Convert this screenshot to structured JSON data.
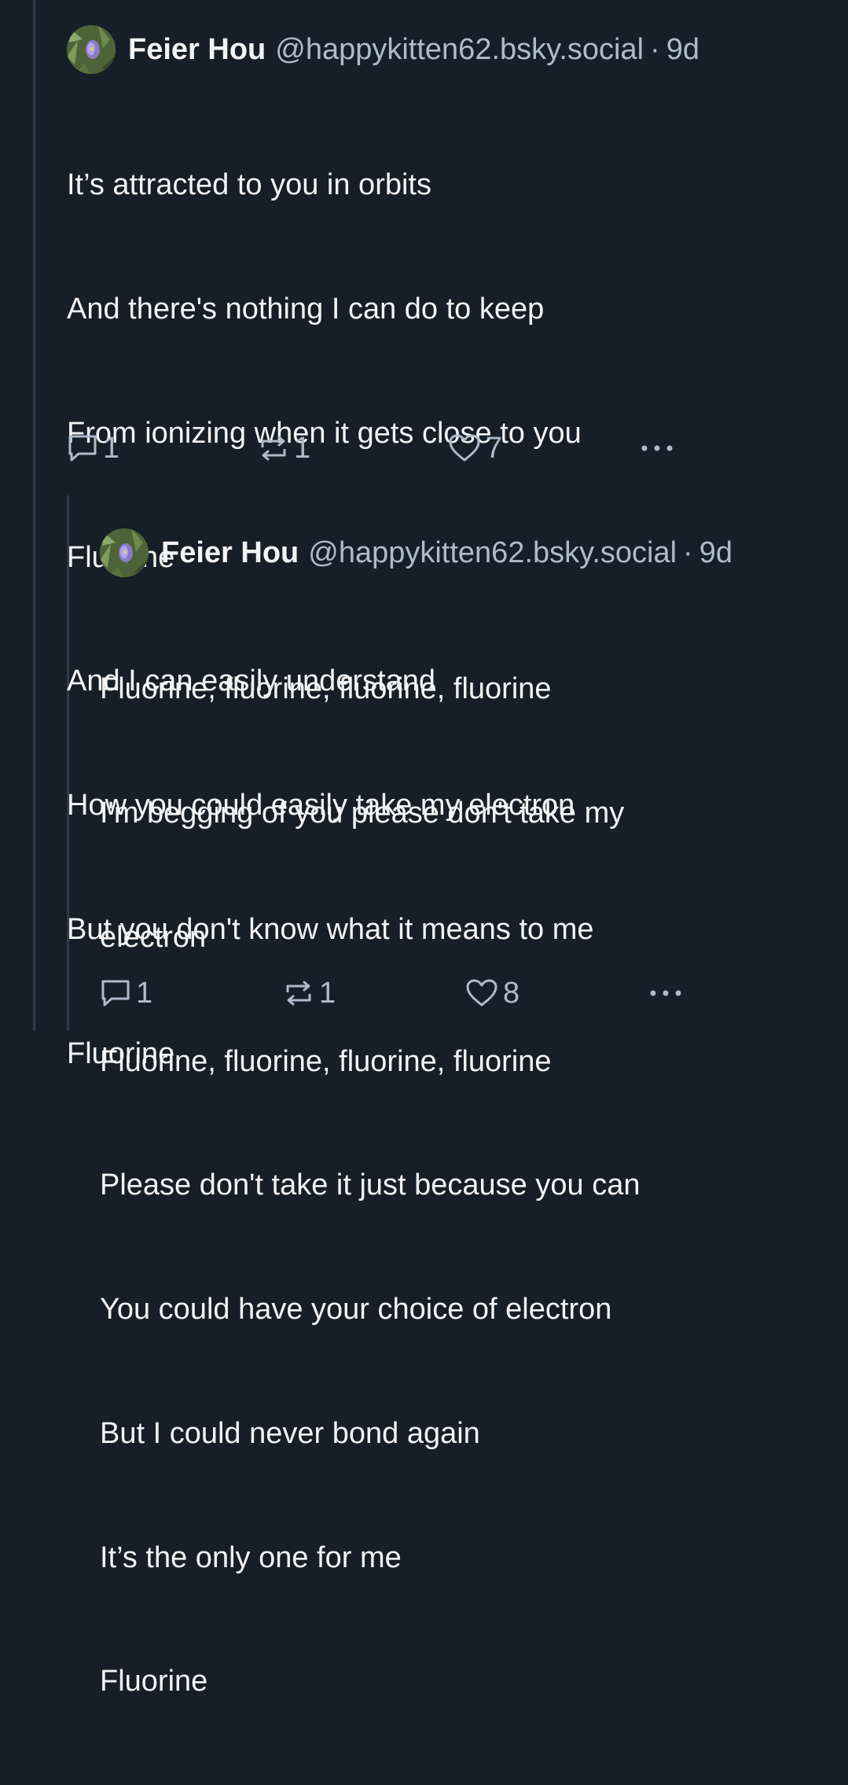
{
  "posts": [
    {
      "author_name": "Feier Hou",
      "handle": "@happykitten62.bsky.social",
      "separator": "·",
      "age": "9d",
      "lines": [
        "It’s attracted to you in orbits",
        "And there's nothing I can do to keep",
        "From ionizing when it gets close to you",
        "Fluorine",
        "And I can easily understand",
        "How you could easily take my electron",
        "But you don't know what it means to me",
        "Fluorine"
      ],
      "reply_count": "1",
      "repost_count": "1",
      "like_count": "7"
    },
    {
      "author_name": "Feier Hou",
      "handle": "@happykitten62.bsky.social",
      "separator": "·",
      "age": "9d",
      "lines": [
        "Fluorine, fluorine, fluorine, fluorine",
        "I'm begging of you please don't take my",
        "electron",
        "Fluorine, fluorine, fluorine, fluorine",
        "Please don't take it just because you can",
        "You could have your choice of electron",
        "But I could never bond again",
        "It’s the only one for me",
        "Fluorine"
      ],
      "reply_count": "1",
      "repost_count": "1",
      "like_count": "8"
    }
  ],
  "colors": {
    "background": "#161e27",
    "text": "#f1f3f5",
    "muted": "#aebbc9",
    "thread_line": "#2e3a47"
  },
  "icons": {
    "reply": "speech-bubble-icon",
    "repost": "repost-arrows-icon",
    "like": "heart-outline-icon",
    "more": "ellipsis-icon"
  }
}
